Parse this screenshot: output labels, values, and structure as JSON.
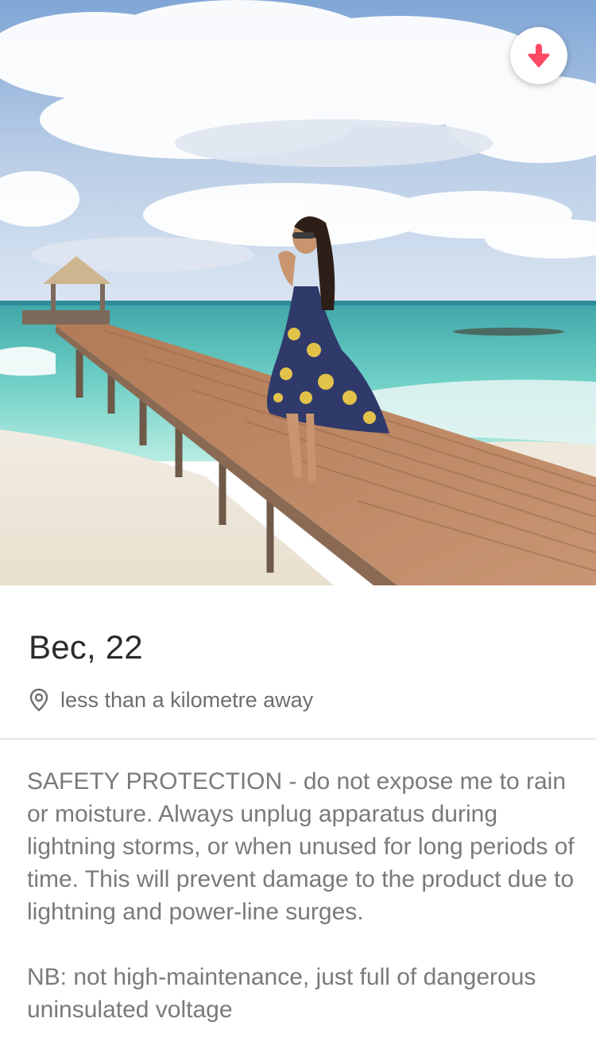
{
  "profile": {
    "name_age": "Bec, 22",
    "distance": "less than a kilometre away",
    "bio": "SAFETY PROTECTION - do not expose me to rain or moisture. Always unplug apparatus during lightning storms, or when unused for long periods of time. This will prevent damage to the product due to lightning and power-line surges.\n\nNB: not high-maintenance, just full of dangerous uninsulated voltage"
  },
  "icons": {
    "collapse": "arrow-down-icon",
    "location": "location-pin-icon"
  },
  "colors": {
    "accent": "#fd4a64",
    "name_text": "#2b2b2b",
    "secondary_text": "#6e6e6e",
    "divider": "#e6e6e6"
  }
}
